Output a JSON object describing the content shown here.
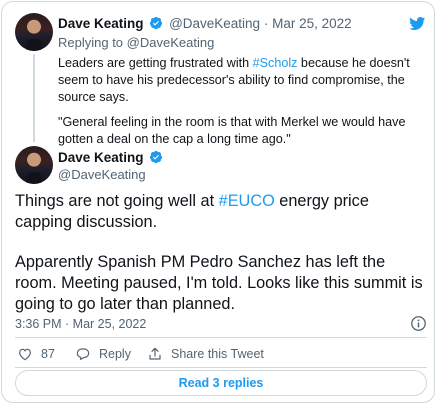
{
  "parent": {
    "author_name": "Dave Keating",
    "author_handle": "@DaveKeating",
    "separator": "·",
    "date": "Mar 25, 2022",
    "replying_prefix": "Replying to",
    "replying_to": "@DaveKeating",
    "text_1_before": "Leaders are getting frustrated with ",
    "text_1_hashtag": "#Scholz",
    "text_1_after": " because he doesn't seem to have his predecessor's ability to find compromise, the source says.",
    "text_2": "\"General feeling in the room is that with Merkel we would have gotten a deal on the cap a long time ago.\""
  },
  "tweet": {
    "author_name": "Dave Keating",
    "author_handle": "@DaveKeating",
    "text_1_before": "Things are not going well at ",
    "text_1_hashtag": "#EUCO",
    "text_1_after": " energy price capping discussion.",
    "text_2": "Apparently Spanish PM Pedro Sanchez has left the room. Meeting paused, I'm told. Looks like this summit is going to go later than planned.",
    "timestamp": "3:36 PM · Mar 25, 2022"
  },
  "actions": {
    "like_count": "87",
    "reply_label": "Reply",
    "share_label": "Share this Tweet"
  },
  "read_replies_label": "Read 3 replies",
  "colors": {
    "accent": "#1d9bf0",
    "muted": "#536471",
    "border": "#cfd9de",
    "text": "#0f1419"
  },
  "icons": [
    "twitter-bird-icon",
    "verified-badge-icon",
    "info-icon",
    "heart-icon",
    "reply-icon",
    "share-icon"
  ]
}
